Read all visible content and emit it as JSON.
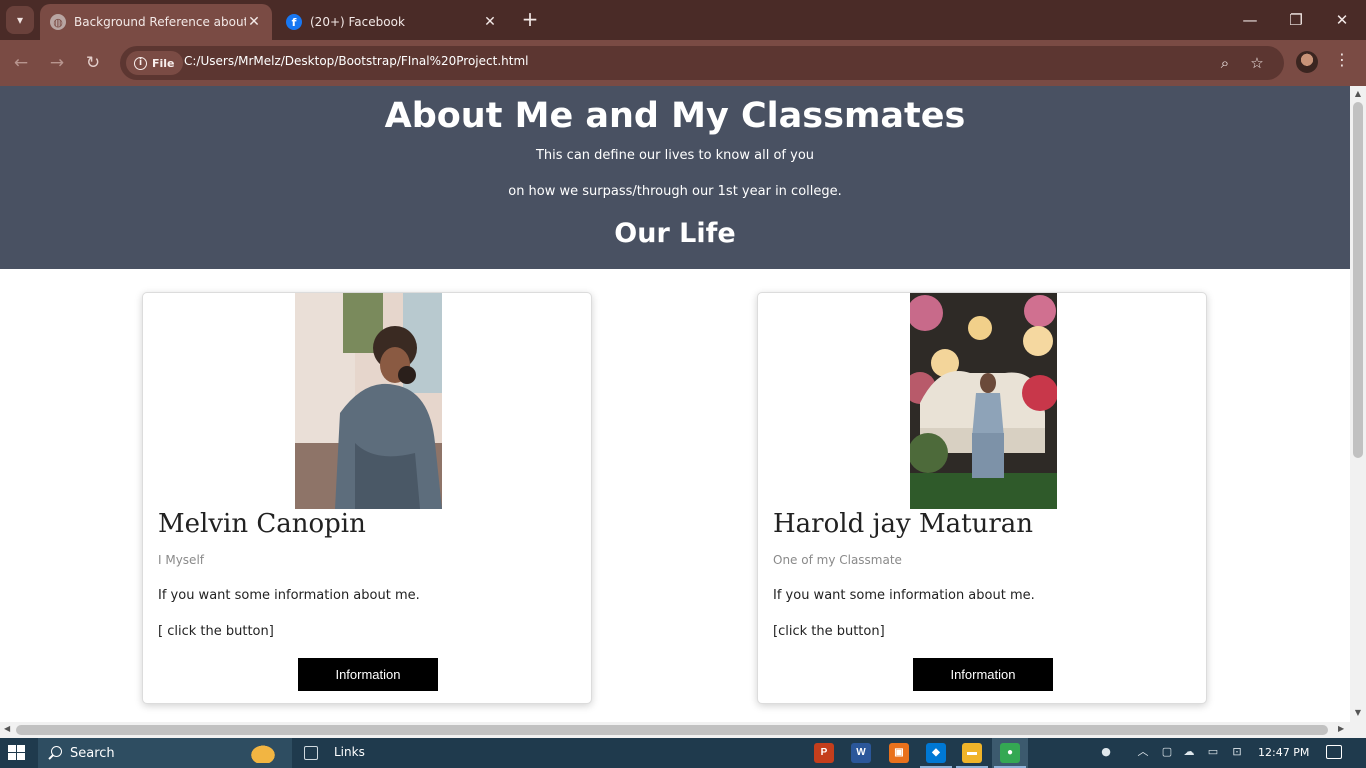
{
  "browser": {
    "tabs": [
      {
        "title": "Background Reference about M",
        "favicon": "globe-icon",
        "active": true
      },
      {
        "title": "(20+) Facebook",
        "favicon": "facebook-icon",
        "active": false
      }
    ],
    "new_tab": "+",
    "site_chip": "File",
    "url": "C:/Users/MrMelz/Desktop/Bootstrap/FInal%20Project.html"
  },
  "page": {
    "title": "About Me and My Classmates",
    "line1": "This can define our lives to know all of you",
    "line2": "on how we surpass/through our 1st year in college.",
    "section_title": "Our Life",
    "cards": [
      {
        "name": "Melvin Canopin",
        "role": "I Myself",
        "info": "If you want some information about me.",
        "click": "[ click the button]",
        "button": "Information"
      },
      {
        "name": "Harold jay Maturan",
        "role": "One of my Classmate",
        "info": "If you want some information about me.",
        "click": "[click the button]",
        "button": "Information"
      }
    ]
  },
  "taskbar": {
    "search_label": "Search",
    "links_label": "Links",
    "apps": [
      {
        "name": "powerpoint-icon",
        "letter": "P",
        "color": "#c43e1c"
      },
      {
        "name": "word-icon",
        "letter": "W",
        "color": "#2b579a"
      },
      {
        "name": "photo-app-icon",
        "letter": "▣",
        "color": "#e9711c"
      },
      {
        "name": "vscode-icon",
        "letter": "◆",
        "color": "#0078d4"
      },
      {
        "name": "file-explorer-icon",
        "letter": "▬",
        "color": "#f0b429"
      },
      {
        "name": "chrome-icon",
        "letter": "●",
        "color": "#34a853"
      }
    ],
    "time": "12:47 PM"
  }
}
